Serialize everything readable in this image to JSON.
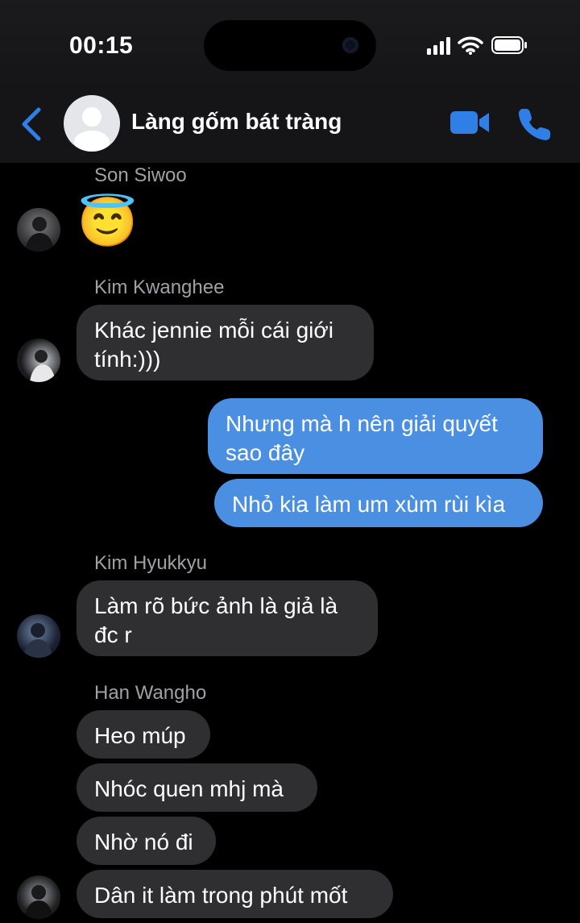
{
  "status": {
    "time": "00:15"
  },
  "header": {
    "title": "Làng gốm bát tràng"
  },
  "messages": {
    "m1": {
      "sender": "Son Siwoo",
      "emoji": "😇"
    },
    "m2": {
      "sender": "Kim Kwanghee",
      "line1": "Khác jennie mỗi cái giới",
      "line2": "tính:)))"
    },
    "m3": {
      "line1": "Nhưng mà h nên giải quyết",
      "line2": "sao đây"
    },
    "m4": {
      "text": "Nhỏ kia làm um xùm rùi kìa"
    },
    "m5": {
      "sender": "Kim Hyukkyu",
      "line1": "Làm rõ bức ảnh là giả là",
      "line2": "đc r"
    },
    "m6": {
      "sender": "Han Wangho",
      "text": "Heo múp"
    },
    "m7": {
      "text": "Nhóc quen mhj mà"
    },
    "m8": {
      "text": "Nhờ nó đi"
    },
    "m9": {
      "text": "Dân it làm trong phút mốt"
    }
  },
  "colors": {
    "accent": "#2f7fe6",
    "outgoing_bubble": "#4a8fe2",
    "incoming_bubble": "#2f2f31"
  }
}
